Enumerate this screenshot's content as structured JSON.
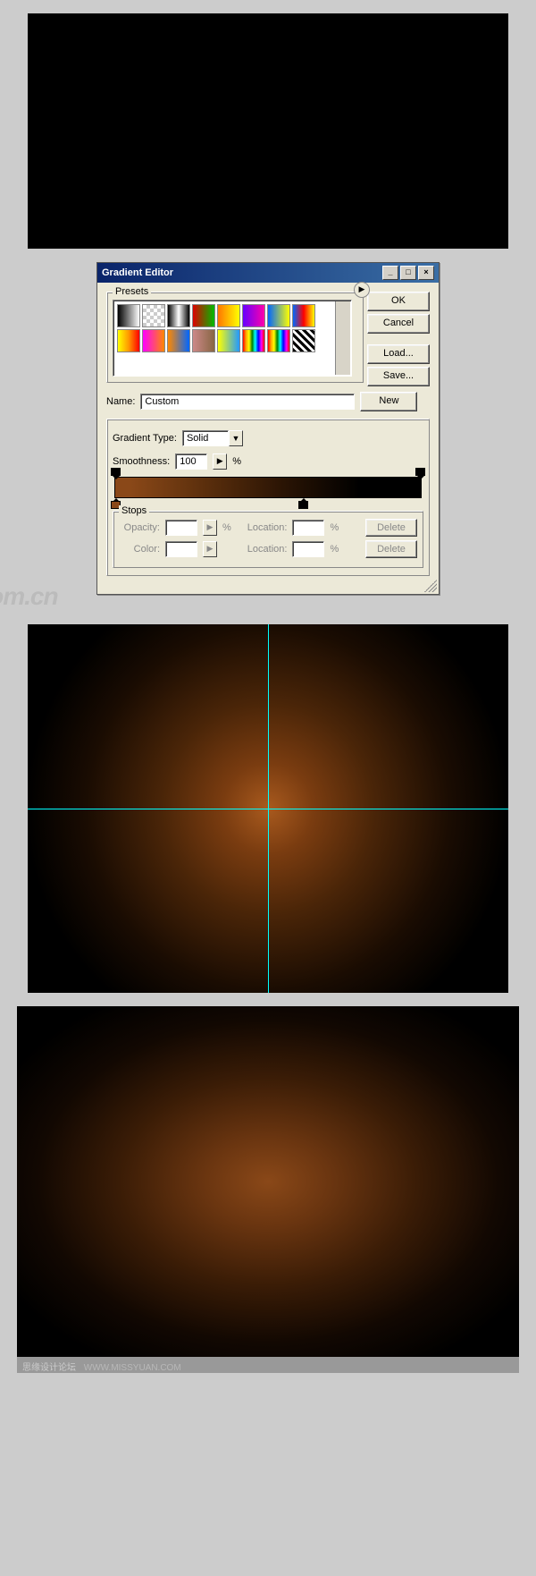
{
  "dialog": {
    "title": "Gradient Editor",
    "buttons": {
      "ok": "OK",
      "cancel": "Cancel",
      "load": "Load...",
      "save": "Save...",
      "new": "New",
      "delete1": "Delete",
      "delete2": "Delete"
    },
    "presets_label": "Presets",
    "name_label": "Name:",
    "name_value": "Custom",
    "gradient_type_label": "Gradient Type:",
    "gradient_type_value": "Solid",
    "smoothness_label": "Smoothness:",
    "smoothness_value": "100",
    "percent": "%",
    "stops_label": "Stops",
    "opacity_label": "Opacity:",
    "location_label": "Location:",
    "color_label": "Color:",
    "gradient_stops": {
      "opacity": [
        {
          "pos": 0
        },
        {
          "pos": 100
        }
      ],
      "color": [
        {
          "pos": 0,
          "color": "#8a4818"
        },
        {
          "pos": 60,
          "color": "#000000"
        }
      ]
    },
    "preset_swatches": [
      "linear-gradient(to right,#000,#fff)",
      "repeating-conic-gradient(#ccc 0 25%,#fff 0 50%) 0/8px 8px",
      "linear-gradient(to right,#000,#fff,#000)",
      "linear-gradient(to right,#d00,#0b0)",
      "linear-gradient(to right,#f70,#ff0)",
      "linear-gradient(to right,#60f,#f0a)",
      "linear-gradient(to right,#06f,#ff0)",
      "linear-gradient(to right,#06f,#f00,#ff0)",
      "linear-gradient(to right,#ff0,#f90,#f00)",
      "linear-gradient(to right,#f0f,#f80)",
      "linear-gradient(to right,#f80,#06f)",
      "linear-gradient(to right,#c88,#864)",
      "linear-gradient(to right,#ff0,#29f)",
      "linear-gradient(to right,red,orange,yellow,green,cyan,blue,magenta,red)",
      "linear-gradient(to right,red,orange,yellow,green,cyan,blue,magenta,red)",
      "repeating-linear-gradient(45deg,#000 0 3px,#fff 3px 6px)"
    ]
  },
  "watermark": "iT.com.cn",
  "footer": {
    "main": "思缘设计论坛",
    "url": "WWW.MISSYUAN.COM"
  }
}
